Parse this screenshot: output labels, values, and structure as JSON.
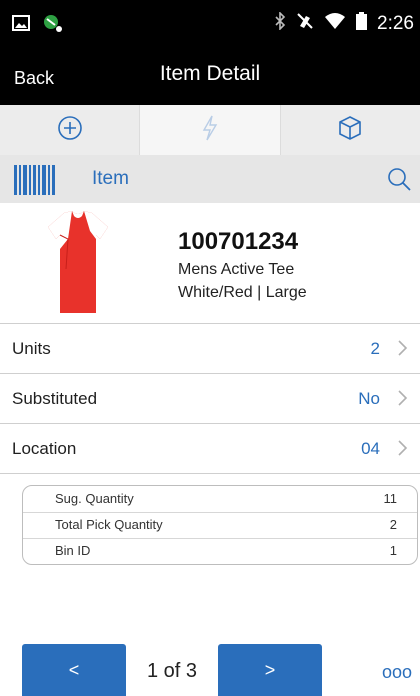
{
  "status_bar": {
    "time": "2:26"
  },
  "header": {
    "back_label": "Back",
    "title": "Item Detail"
  },
  "tabs": [
    {
      "icon": "add-circle-icon"
    },
    {
      "icon": "lightning-icon"
    },
    {
      "icon": "box-icon"
    }
  ],
  "item_search": {
    "label": "Item"
  },
  "product": {
    "sku": "100701234",
    "description": "Mens Active Tee",
    "variant": "White/Red | Large"
  },
  "rows": [
    {
      "label": "Units",
      "value": "2"
    },
    {
      "label": "Substituted",
      "value": "No"
    },
    {
      "label": "Location",
      "value": "04"
    }
  ],
  "info": [
    {
      "label": "Sug. Quantity",
      "value": "11"
    },
    {
      "label": "Total Pick Quantity",
      "value": "2"
    },
    {
      "label": "Bin ID",
      "value": "1"
    }
  ],
  "footer": {
    "prev_label": "<",
    "page_text": "1 of 3",
    "next_label": ">",
    "more_label": "ooo"
  },
  "colors": {
    "accent": "#2a6ebb",
    "header_bg": "#000000",
    "tab_bg": "#ececec"
  }
}
